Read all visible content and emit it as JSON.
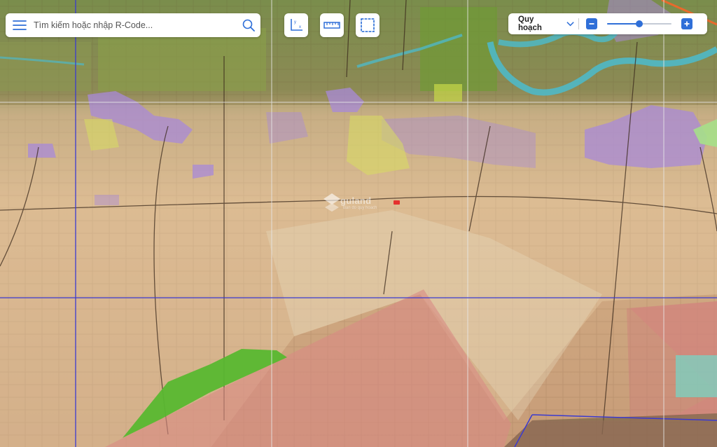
{
  "search": {
    "placeholder": "Tìm kiếm hoặc nhập R-Code..."
  },
  "toolbar": {
    "coord_tool": {
      "icon": "xy-axis-icon"
    },
    "measure_tool": {
      "icon": "ruler-icon"
    },
    "area_tool": {
      "icon": "dashed-square-icon"
    }
  },
  "layer_control": {
    "selected": "Quy hoạch",
    "opacity_fraction": 0.5
  },
  "map": {
    "watermark": "guland",
    "watermark_sub": "Ban do quy hoach"
  },
  "colors": {
    "accent": "#2f6fd8",
    "grid_blue": "#3a3ad0",
    "grid_white": "#e8e8e8",
    "zone_pink": "#d98a84",
    "zone_green": "#58b830",
    "zone_purple": "#a98ad8",
    "river": "#4fb8c6"
  }
}
